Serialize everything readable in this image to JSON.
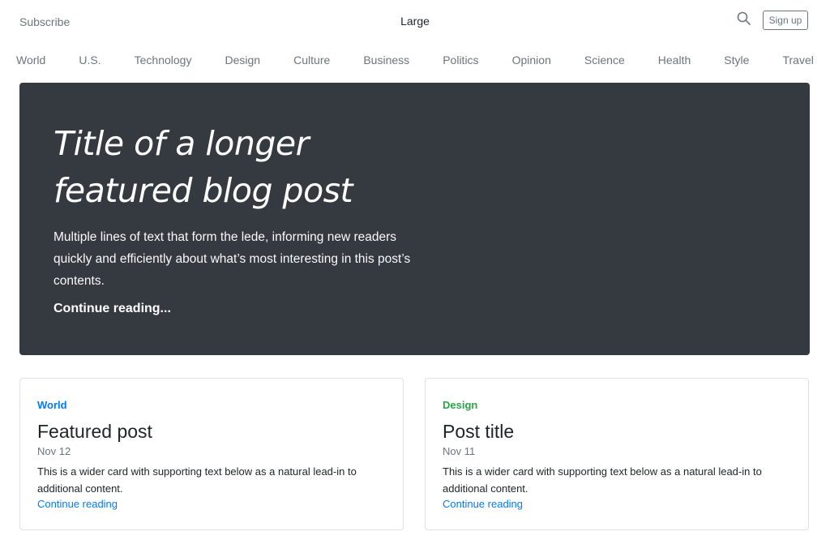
{
  "header": {
    "subscribe": "Subscribe",
    "brand": "Large",
    "search_icon": "search-icon",
    "signup": "Sign up"
  },
  "nav": [
    "World",
    "U.S.",
    "Technology",
    "Design",
    "Culture",
    "Business",
    "Politics",
    "Opinion",
    "Science",
    "Health",
    "Style",
    "Travel"
  ],
  "hero": {
    "title_line1": "Title of a longer",
    "title_line2": "featured blog post",
    "lede": "Multiple lines of text that form the lede, informing new readers quickly and efficiently about what’s most interesting in this post’s contents.",
    "link": "Continue reading...",
    "background": "#343a40"
  },
  "cards": [
    {
      "category": "World",
      "category_color": "#007bff",
      "title": "Featured post",
      "date": "Nov 12",
      "text": "This is a wider card with supporting text below as a natural lead-in to additional content.",
      "link": "Continue reading"
    },
    {
      "category": "Design",
      "category_color": "#28a745",
      "title": "Post title",
      "date": "Nov 11",
      "text": "This is a wider card with supporting text below as a natural lead-in to additional content.",
      "link": "Continue reading"
    }
  ]
}
